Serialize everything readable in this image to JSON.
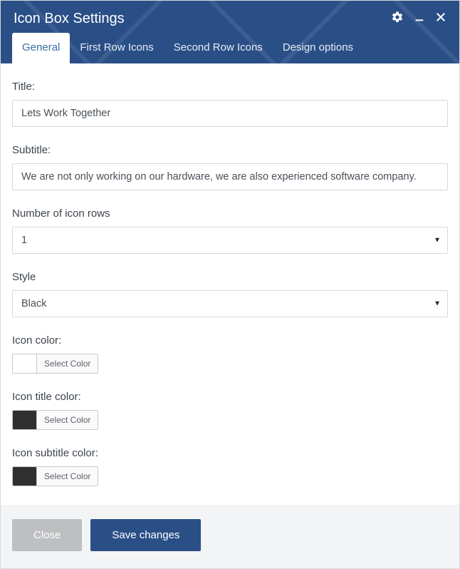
{
  "header": {
    "title": "Icon Box Settings"
  },
  "tabs": [
    {
      "label": "General",
      "active": true
    },
    {
      "label": "First Row Icons",
      "active": false
    },
    {
      "label": "Second Row Icons",
      "active": false
    },
    {
      "label": "Design options",
      "active": false
    }
  ],
  "fields": {
    "title_label": "Title:",
    "title_value": "Lets Work Together",
    "subtitle_label": "Subtitle:",
    "subtitle_value": "We are not only working on our hardware, we are also experienced software company.",
    "rows_label": "Number of icon rows",
    "rows_value": "1",
    "style_label": "Style",
    "style_value": "Black",
    "icon_color_label": "Icon color:",
    "icon_color_value": "#1ec7d8",
    "icon_title_color_label": "Icon title color:",
    "icon_title_color_value": "#2f2f2f",
    "icon_subtitle_color_label": "Icon subtitle color:",
    "icon_subtitle_color_value": "#2f2f2f",
    "select_color_btn": "Select Color"
  },
  "footer": {
    "close": "Close",
    "save": "Save changes"
  }
}
